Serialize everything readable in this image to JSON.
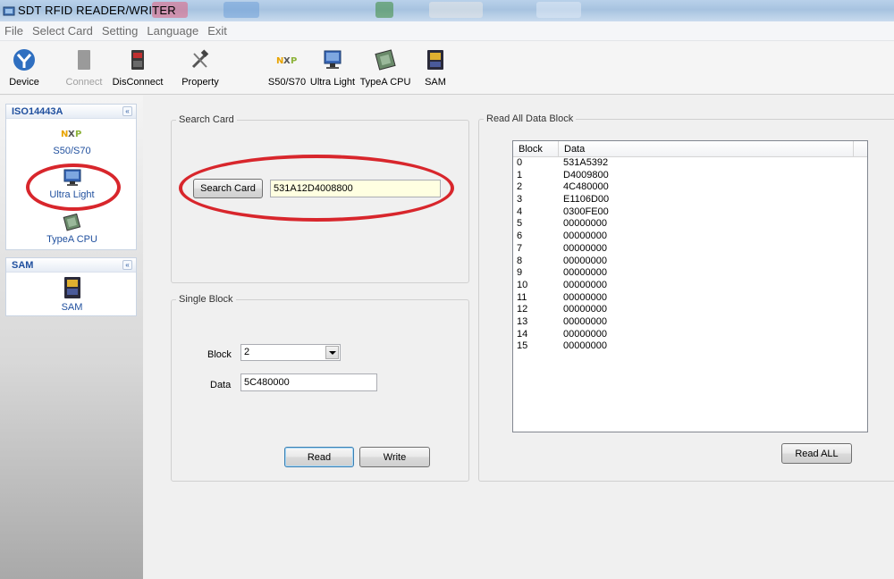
{
  "window": {
    "title": "SDT RFID READER/WRITER"
  },
  "menu": [
    "File",
    "Select Card",
    "Setting",
    "Language",
    "Exit"
  ],
  "toolbar": {
    "device": "Device",
    "connect": "Connect",
    "disconnect": "DisConnect",
    "property": "Property",
    "s50": "S50/S70",
    "ultralight": "Ultra Light",
    "typea": "TypeA CPU",
    "sam": "SAM"
  },
  "sidebar": {
    "iso_title": "ISO14443A",
    "iso_items": [
      "S50/S70",
      "Ultra Light",
      "TypeA CPU"
    ],
    "sam_title": "SAM",
    "sam_items": [
      "SAM"
    ],
    "collapse_glyph": "«"
  },
  "search_card": {
    "legend": "Search Card",
    "button": "Search Card",
    "value": "531A12D4008800"
  },
  "single_block": {
    "legend": "Single Block",
    "block_label": "Block",
    "block_value": "2",
    "data_label": "Data",
    "data_value": "5C480000",
    "read_button": "Read",
    "write_button": "Write"
  },
  "read_all": {
    "legend": "Read All Data Block",
    "col_block": "Block",
    "col_data": "Data",
    "rows": [
      [
        "0",
        "531A5392"
      ],
      [
        "1",
        "D4009800"
      ],
      [
        "2",
        "4C480000"
      ],
      [
        "3",
        "E1106D00"
      ],
      [
        "4",
        "0300FE00"
      ],
      [
        "5",
        "00000000"
      ],
      [
        "6",
        "00000000"
      ],
      [
        "7",
        "00000000"
      ],
      [
        "8",
        "00000000"
      ],
      [
        "9",
        "00000000"
      ],
      [
        "10",
        "00000000"
      ],
      [
        "11",
        "00000000"
      ],
      [
        "12",
        "00000000"
      ],
      [
        "13",
        "00000000"
      ],
      [
        "14",
        "00000000"
      ],
      [
        "15",
        "00000000"
      ]
    ],
    "button": "Read ALL"
  },
  "colors": {
    "highlight_ellipse": "#d8262c",
    "sidebar_text": "#1f4f9e"
  }
}
